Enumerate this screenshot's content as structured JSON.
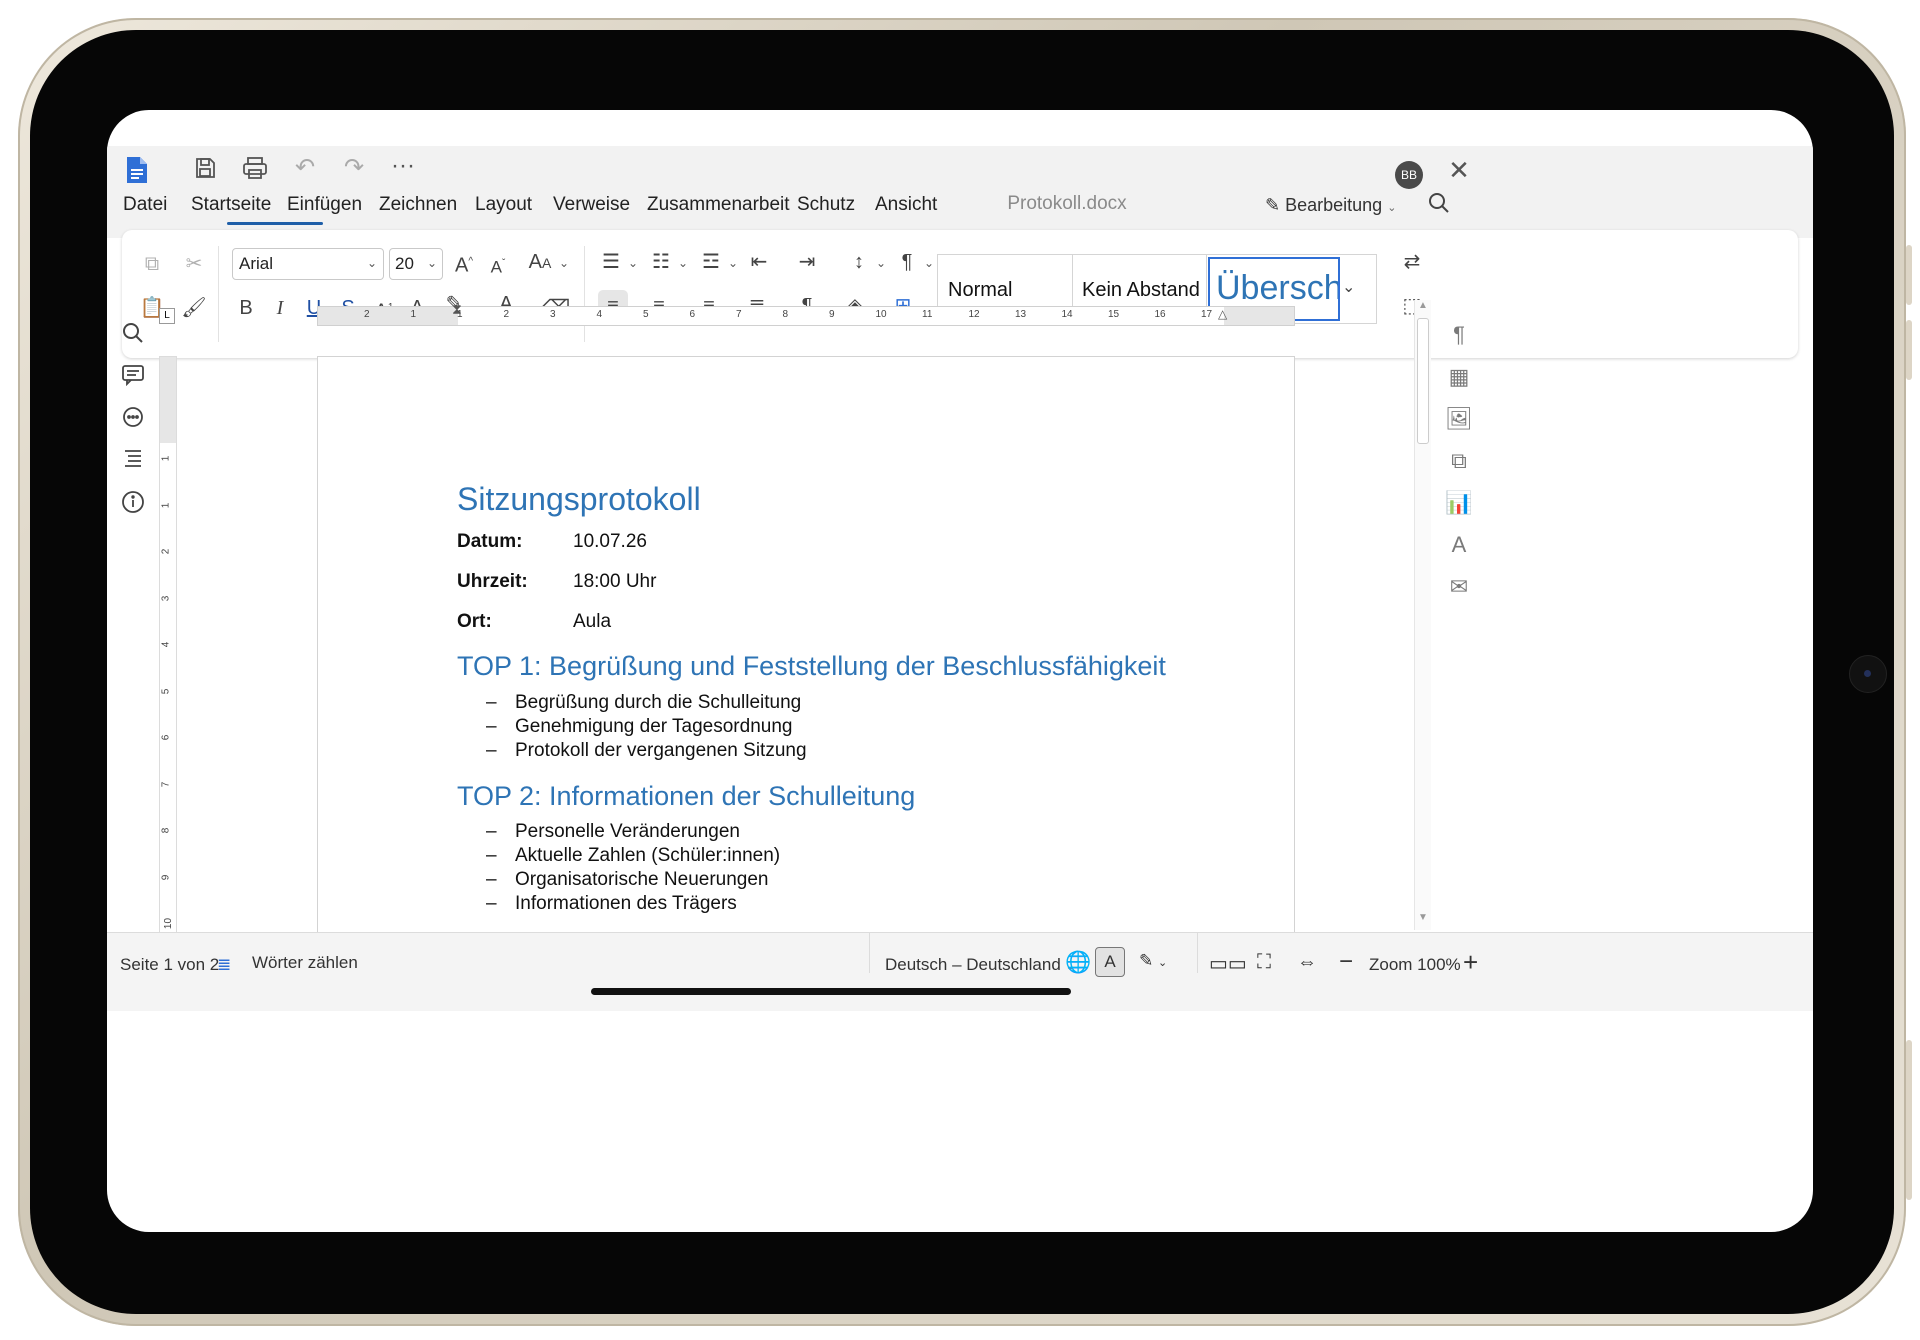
{
  "window": {
    "title": "Protokoll.docx",
    "avatar": "BB"
  },
  "menu": {
    "tabs": [
      "Datei",
      "Startseite",
      "Einfügen",
      "Zeichnen",
      "Layout",
      "Verweise",
      "Zusammenarbeit",
      "Schutz",
      "Ansicht"
    ],
    "active": "Startseite",
    "mode": "Bearbeitung"
  },
  "ribbon": {
    "font": "Arial",
    "size": "20",
    "styles": [
      "Normal",
      "Kein Abstand",
      "Übersch"
    ],
    "selected_style": "Übersch"
  },
  "ruler": {
    "h_ticks": [
      "2",
      "1",
      "1",
      "2",
      "3",
      "4",
      "5",
      "6",
      "7",
      "8",
      "9",
      "10",
      "11",
      "12",
      "13",
      "14",
      "15",
      "16",
      "17"
    ],
    "v_ticks": [
      "1",
      "1",
      "2",
      "3",
      "4",
      "5",
      "6",
      "7",
      "8",
      "9",
      "10"
    ]
  },
  "document": {
    "title": "Sitzungsprotokoll",
    "meta": [
      {
        "label": "Datum:",
        "value": "10.07.26"
      },
      {
        "label": "Uhrzeit:",
        "value": "18:00 Uhr"
      },
      {
        "label": "Ort:",
        "value": "Aula"
      }
    ],
    "sections": [
      {
        "heading": "TOP 1: Begrüßung und Feststellung der Beschlussfähigkeit",
        "items": [
          "Begrüßung durch die Schulleitung",
          "Genehmigung der Tagesordnung",
          "Protokoll der vergangenen Sitzung"
        ]
      },
      {
        "heading": "TOP 2: Informationen der Schulleitung",
        "items": [
          "Personelle Veränderungen",
          "Aktuelle Zahlen (Schüler:innen)",
          "Organisatorische Neuerungen",
          "Informationen des Trägers"
        ]
      }
    ],
    "bullet_char": "–"
  },
  "status": {
    "page": "Seite 1 von 2",
    "word_count": "Wörter zählen",
    "language": "Deutsch – Deutschland",
    "zoom": "Zoom 100%"
  },
  "colors": {
    "accent": "#2e74b5",
    "tab_underline": "#1f5fa8",
    "highlight": "#f4e200",
    "selected_style_border": "#2f6fd6"
  }
}
